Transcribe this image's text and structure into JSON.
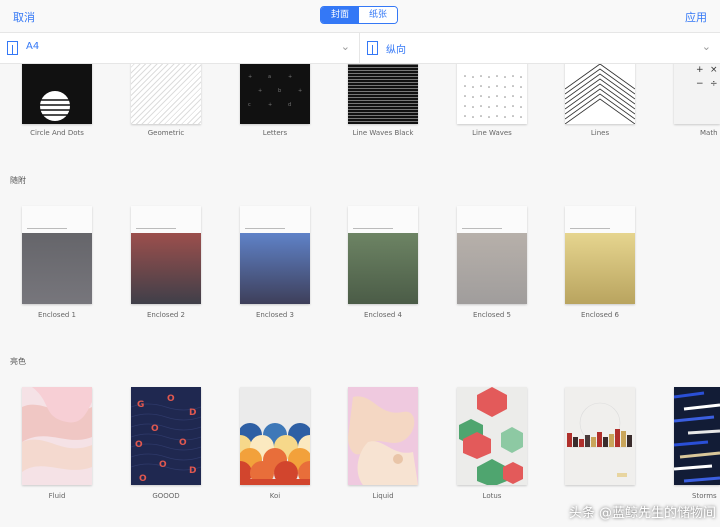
{
  "header": {
    "cancel": "取消",
    "apply": "应用",
    "segments": [
      {
        "label": "封面",
        "active": true
      },
      {
        "label": "纸张",
        "active": false
      }
    ]
  },
  "options": {
    "paper_size": "A4",
    "orientation": "纵向"
  },
  "sections": {
    "top_row": {
      "items": [
        "Circle And Dots",
        "Geometric",
        "Letters",
        "Line Waves Black",
        "Line Waves",
        "Lines",
        "Math"
      ]
    },
    "enclosed": {
      "title": "随附",
      "items": [
        {
          "label": "Enclosed 1",
          "color_top": "#65656a",
          "color_bottom": "#77767c"
        },
        {
          "label": "Enclosed 2",
          "color_top": "#9c4f4c",
          "color_bottom": "#3f3f49"
        },
        {
          "label": "Enclosed 3",
          "color_top": "#5f82c8",
          "color_bottom": "#3e3f5a"
        },
        {
          "label": "Enclosed 4",
          "color_top": "#6d8464",
          "color_bottom": "#4b5c47"
        },
        {
          "label": "Enclosed 5",
          "color_top": "#b7b0aa",
          "color_bottom": "#a09d9c"
        },
        {
          "label": "Enclosed 6",
          "color_top": "#e6d58f",
          "color_bottom": "#b9a45f"
        }
      ]
    },
    "bright": {
      "title": "亮色",
      "items": [
        "Fluid",
        "GOOOD",
        "Koi",
        "Liquid",
        "Lotus",
        "",
        "Storms"
      ]
    }
  },
  "watermark": "头条 @蓝鲸先生的储物间"
}
